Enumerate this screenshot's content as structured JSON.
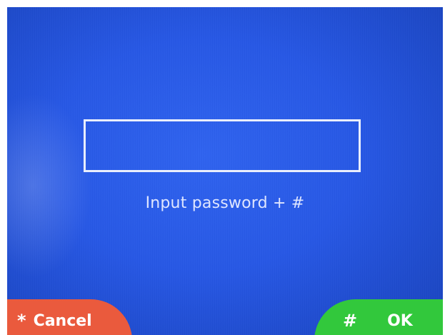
{
  "screen": {
    "password_value": "",
    "prompt": "Input password + #"
  },
  "softkeys": {
    "cancel": {
      "glyph": "*",
      "label": "Cancel"
    },
    "ok": {
      "glyph": "#",
      "label": "OK"
    }
  },
  "colors": {
    "background": "#2758e6",
    "cancel_key": "#ea5a3d",
    "ok_key": "#32c83c",
    "text": "#dfe6ff"
  }
}
